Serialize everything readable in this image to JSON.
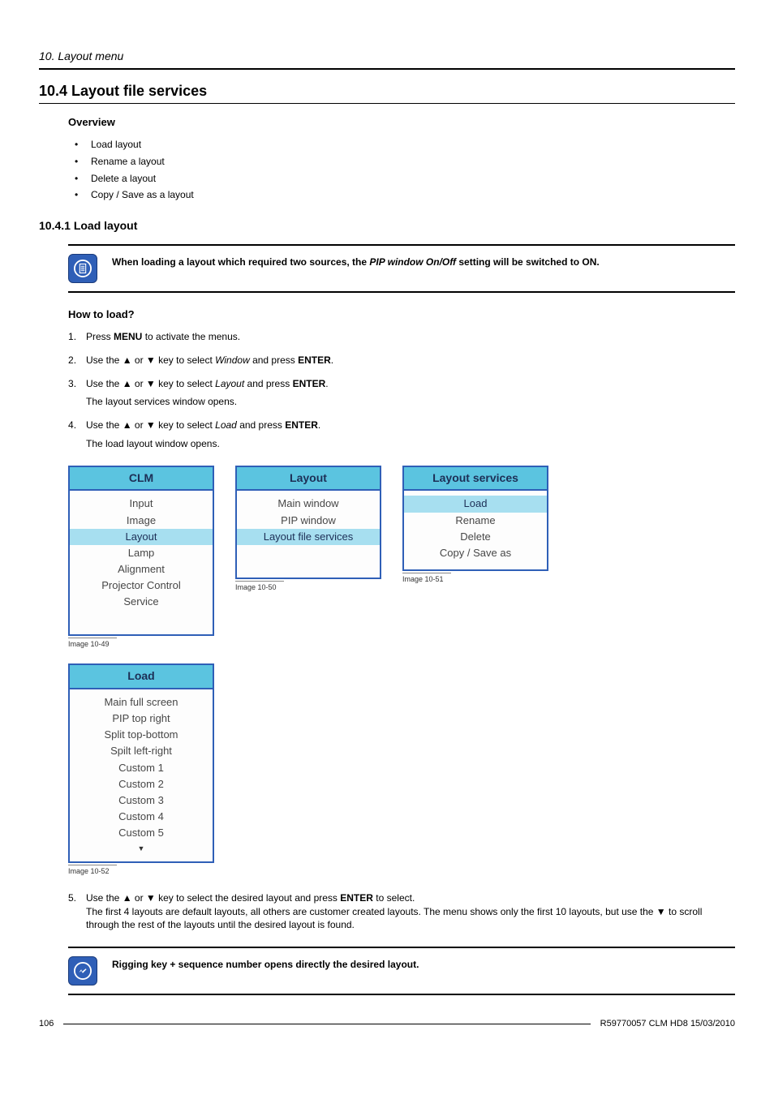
{
  "breadcrumb": "10.  Layout menu",
  "h1": "10.4  Layout file services",
  "overview_title": "Overview",
  "overview_items": [
    "Load layout",
    "Rename a layout",
    "Delete a layout",
    "Copy / Save as a layout"
  ],
  "sub_h2": "10.4.1  Load layout",
  "note1_prefix": "When loading a layout which required two sources, the ",
  "note1_ital": "PIP window On/Off",
  "note1_suffix": " setting will be switched to ON.",
  "howto_title": "How to load?",
  "steps": {
    "s1_a": "Press ",
    "s1_b": "MENU",
    "s1_c": " to activate the menus.",
    "s2_a": "Use the ▲ or ▼ key to select ",
    "s2_b": "Window",
    "s2_c": " and press ",
    "s2_d": "ENTER",
    "s2_e": ".",
    "s3_a": "Use the ▲ or ▼ key to select ",
    "s3_b": "Layout",
    "s3_c": " and press ",
    "s3_d": "ENTER",
    "s3_e": ".",
    "s3_sub": "The layout services window opens.",
    "s4_a": "Use the ▲ or ▼ key to select ",
    "s4_b": "Load",
    "s4_c": " and press ",
    "s4_d": "ENTER",
    "s4_e": ".",
    "s4_sub": "The load layout window opens."
  },
  "menu1": {
    "title": "CLM",
    "items": [
      "Input",
      "Image",
      "Layout",
      "Lamp",
      "Alignment",
      "Projector Control",
      "Service"
    ],
    "selected": "Layout",
    "caption": "Image 10-49"
  },
  "menu2": {
    "title": "Layout",
    "items": [
      "Main window",
      "PIP window",
      "Layout file services"
    ],
    "selected": "Layout file services",
    "caption": "Image 10-50"
  },
  "menu3": {
    "title": "Layout services",
    "items": [
      "Load",
      "Rename",
      "Delete",
      "Copy / Save as"
    ],
    "selected": "Load",
    "caption": "Image 10-51"
  },
  "menu4": {
    "title": "Load",
    "items": [
      "Main full screen",
      "PIP top right",
      "Split top-bottom",
      "Spilt left-right",
      "Custom 1",
      "Custom 2",
      "Custom 3",
      "Custom 4",
      "Custom 5"
    ],
    "arrow": "▼",
    "caption": "Image 10-52"
  },
  "step5_num": "5.",
  "step5_a": "Use the ▲ or ▼ key to select the desired layout and press ",
  "step5_b": "ENTER",
  "step5_c": " to select.",
  "step5_sub": "The first 4 layouts are default layouts, all others are customer created layouts. The menu shows only the first 10 layouts, but use the ▼ to scroll through the rest of the layouts until the desired layout is found.",
  "note2": "Rigging key + sequence number opens directly the desired layout.",
  "footer_page": "106",
  "footer_doc": "R59770057  CLM HD8  15/03/2010"
}
